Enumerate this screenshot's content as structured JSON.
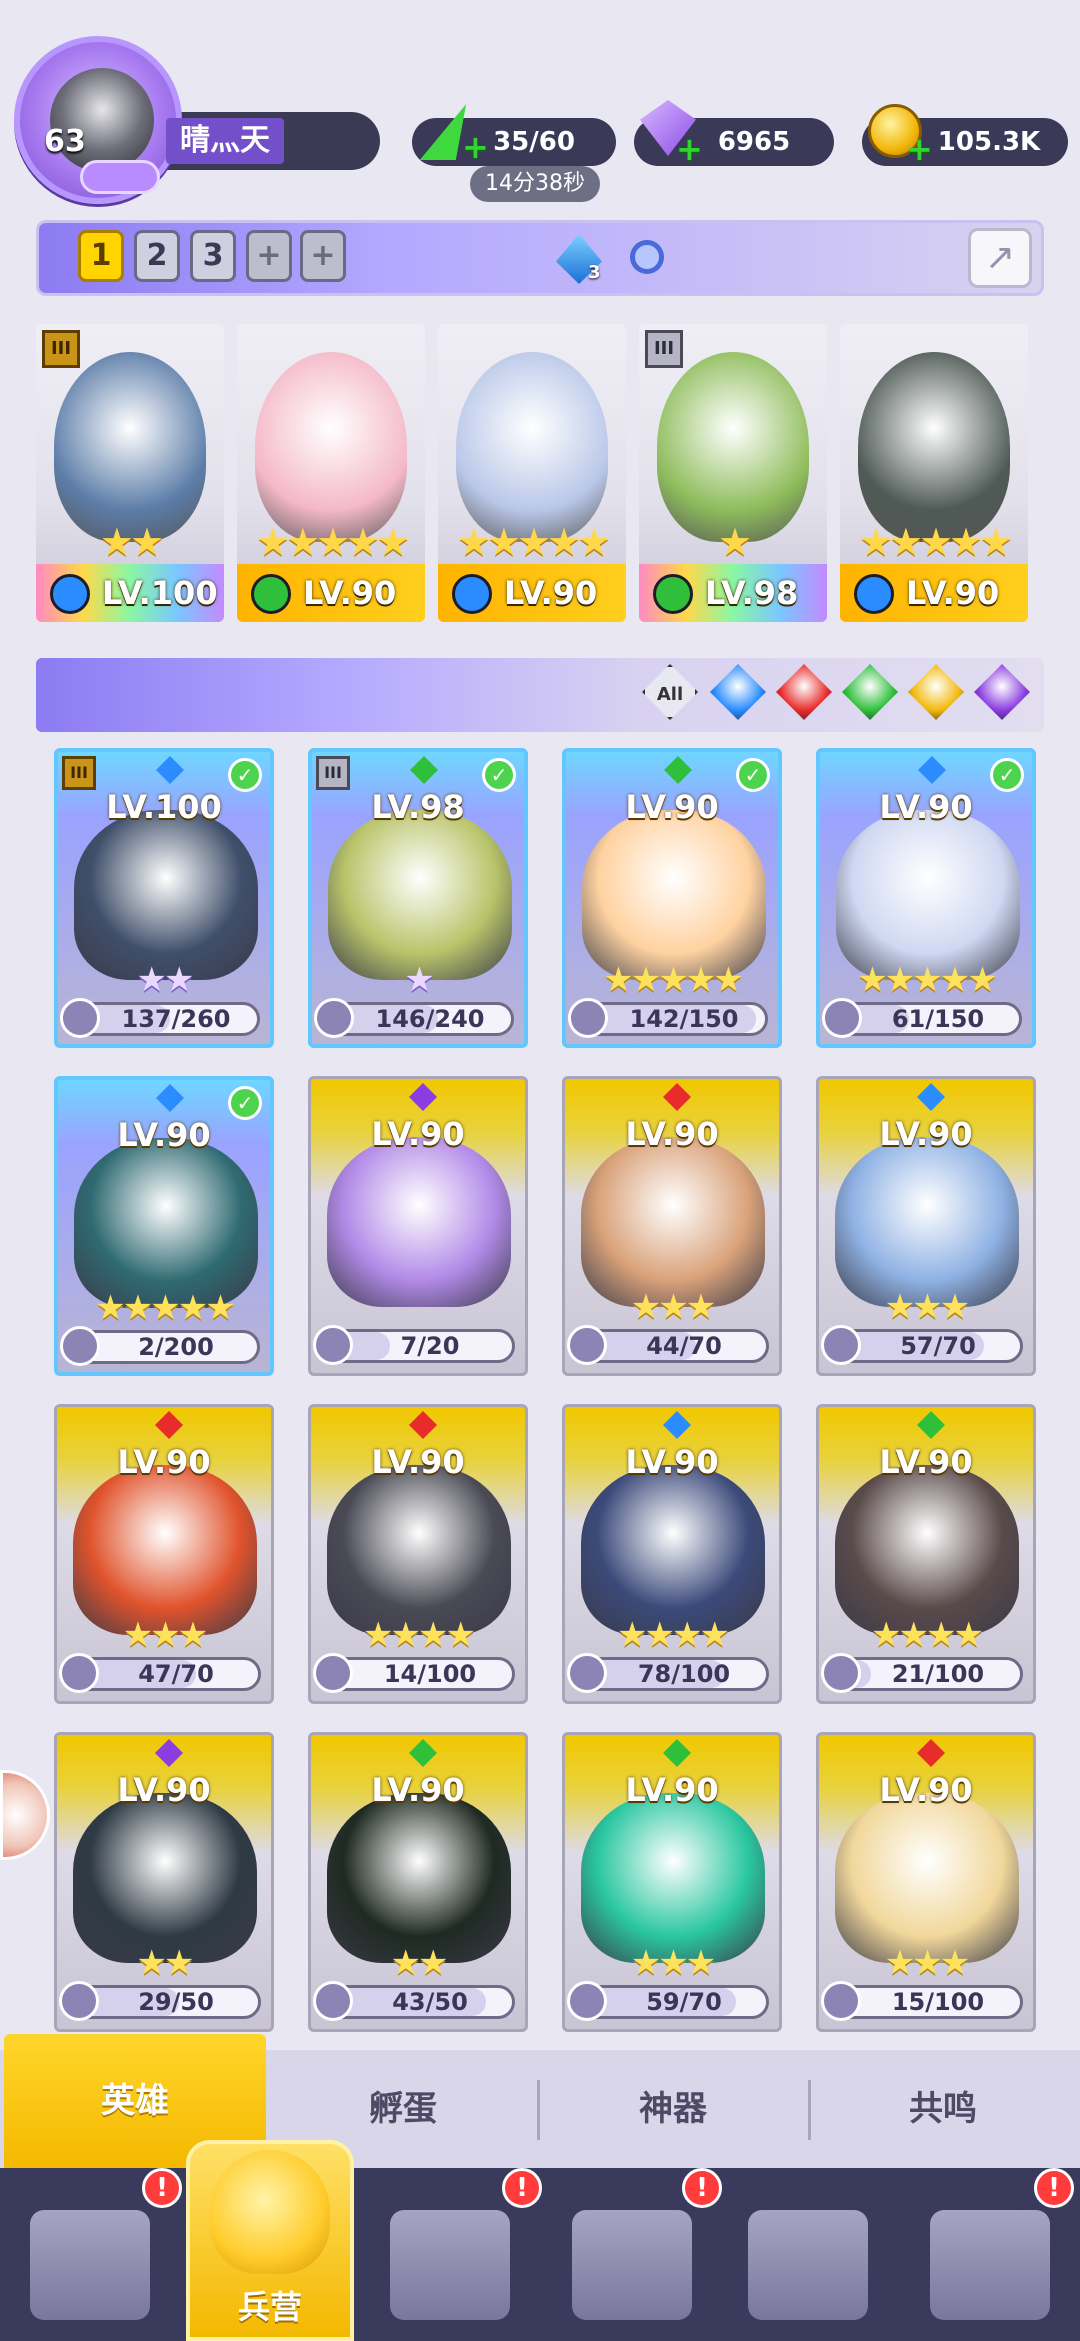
{
  "player": {
    "level": "63",
    "name": "晴灬天"
  },
  "resources": {
    "energy": "35/60",
    "energy_timer": "14分38秒",
    "gems": "6965",
    "gold": "105.3K"
  },
  "team_tabs": [
    "1",
    "2",
    "3",
    "+",
    "+"
  ],
  "team_power_badge": "3",
  "team_heroes": [
    {
      "level": "LV.100",
      "stars": "★★",
      "element_color": "#2a8cff",
      "rank": "III",
      "bar": "rainbow",
      "art": "#5c7da8"
    },
    {
      "level": "LV.90",
      "stars": "★★★★★",
      "element_color": "#2fbf3b",
      "rank": "",
      "bar": "gold",
      "art": "#f4b8c8"
    },
    {
      "level": "LV.90",
      "stars": "★★★★★",
      "element_color": "#2a8cff",
      "rank": "",
      "bar": "gold",
      "art": "#b9c7e8"
    },
    {
      "level": "LV.98",
      "stars": "★",
      "element_color": "#2fbf3b",
      "rank": "III",
      "bar": "rainbow",
      "art": "#8fbd5c"
    },
    {
      "level": "LV.90",
      "stars": "★★★★★",
      "element_color": "#2a8cff",
      "rank": "",
      "bar": "gold",
      "art": "#4f5a55"
    }
  ],
  "filter": {
    "all_label": "All",
    "elements": [
      {
        "name": "water",
        "color": "#2a8cff"
      },
      {
        "name": "fire",
        "color": "#e82b2b"
      },
      {
        "name": "wind",
        "color": "#2fbf3b"
      },
      {
        "name": "light",
        "color": "#f2b90a"
      },
      {
        "name": "dark",
        "color": "#8a3de0"
      }
    ]
  },
  "heroes": [
    {
      "level": "LV.100",
      "shards": "137/260",
      "fill": 0.53,
      "stars": "★★",
      "star_style": "purple",
      "element_color": "#2a8cff",
      "in_team": true,
      "rank": "III",
      "art": "#3f4f6a"
    },
    {
      "level": "LV.98",
      "shards": "146/240",
      "fill": 0.61,
      "stars": "★",
      "star_style": "purple",
      "element_color": "#2fbf3b",
      "in_team": true,
      "rank": "III",
      "art": "#b8c46a"
    },
    {
      "level": "LV.90",
      "shards": "142/150",
      "fill": 0.95,
      "stars": "★★★★★",
      "star_style": "gold",
      "element_color": "#2fbf3b",
      "in_team": true,
      "rank": "",
      "art": "#ffd2a0"
    },
    {
      "level": "LV.90",
      "shards": "61/150",
      "fill": 0.41,
      "stars": "★★★★★",
      "star_style": "gold",
      "element_color": "#2a8cff",
      "in_team": true,
      "rank": "",
      "art": "#cfd8f2"
    },
    {
      "level": "LV.90",
      "shards": "2/200",
      "fill": 0.01,
      "stars": "★★★★★",
      "star_style": "gold",
      "element_color": "#2a8cff",
      "in_team": true,
      "rank": "",
      "art": "#2f6a72"
    },
    {
      "level": "LV.90",
      "shards": "7/20",
      "fill": 0.35,
      "stars": "",
      "star_style": "gold",
      "element_color": "#8a3de0",
      "in_team": false,
      "rank": "",
      "art": "#b28ae8"
    },
    {
      "level": "LV.90",
      "shards": "44/70",
      "fill": 0.63,
      "stars": "★★★",
      "star_style": "gold",
      "element_color": "#e82b2b",
      "in_team": false,
      "rank": "",
      "art": "#d9a27a"
    },
    {
      "level": "LV.90",
      "shards": "57/70",
      "fill": 0.81,
      "stars": "★★★",
      "star_style": "gold",
      "element_color": "#2a8cff",
      "in_team": false,
      "rank": "",
      "art": "#8fb2e4"
    },
    {
      "level": "LV.90",
      "shards": "47/70",
      "fill": 0.67,
      "stars": "★★★",
      "star_style": "gold",
      "element_color": "#e82b2b",
      "in_team": false,
      "rank": "",
      "art": "#e0532c"
    },
    {
      "level": "LV.90",
      "shards": "14/100",
      "fill": 0.14,
      "stars": "★★★★",
      "star_style": "gold",
      "element_color": "#e82b2b",
      "in_team": false,
      "rank": "",
      "art": "#4a4a55"
    },
    {
      "level": "LV.90",
      "shards": "78/100",
      "fill": 0.78,
      "stars": "★★★★",
      "star_style": "gold",
      "element_color": "#2a8cff",
      "in_team": false,
      "rank": "",
      "art": "#3b4a7a"
    },
    {
      "level": "LV.90",
      "shards": "21/100",
      "fill": 0.21,
      "stars": "★★★★",
      "star_style": "gold",
      "element_color": "#2fbf3b",
      "in_team": false,
      "rank": "",
      "art": "#5a4a4a"
    },
    {
      "level": "LV.90",
      "shards": "29/50",
      "fill": 0.58,
      "stars": "★★",
      "star_style": "gold",
      "element_color": "#8a3de0",
      "in_team": false,
      "rank": "",
      "art": "#2e3a44"
    },
    {
      "level": "LV.90",
      "shards": "43/50",
      "fill": 0.86,
      "stars": "★★",
      "star_style": "gold",
      "element_color": "#2fbf3b",
      "in_team": false,
      "rank": "",
      "art": "#1f2a22"
    },
    {
      "level": "LV.90",
      "shards": "59/70",
      "fill": 0.84,
      "stars": "★★★",
      "star_style": "gold",
      "element_color": "#2fbf3b",
      "in_team": false,
      "rank": "",
      "art": "#2ac7a0"
    },
    {
      "level": "LV.90",
      "shards": "15/100",
      "fill": 0.15,
      "stars": "★★★",
      "star_style": "gold",
      "element_color": "#e82b2b",
      "in_team": false,
      "rank": "",
      "art": "#f1d79a"
    }
  ],
  "sub_tabs": [
    "英雄",
    "孵蛋",
    "神器",
    "共鸣"
  ],
  "bottom_nav": {
    "active_label": "兵营",
    "badge": "!"
  }
}
